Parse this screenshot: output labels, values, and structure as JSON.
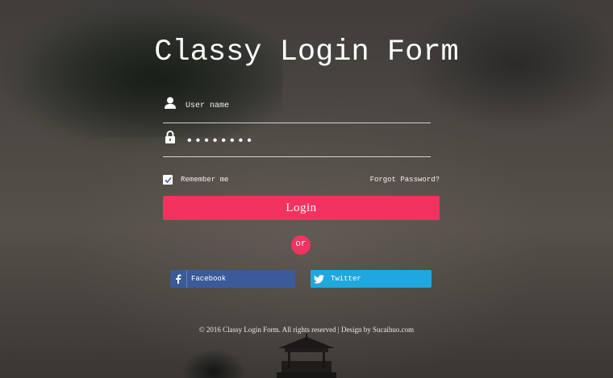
{
  "title": "Classy Login Form",
  "username": {
    "placeholder": "User name",
    "icon": "user-icon"
  },
  "password": {
    "value": "••••••••",
    "icon": "lock-icon"
  },
  "remember": {
    "label": "Remember me",
    "checked": true
  },
  "forgot_label": "Forgot Password?",
  "login_label": "Login",
  "or_label": "or",
  "social": {
    "facebook": {
      "label": "Facebook",
      "icon": "facebook-icon",
      "color": "#3b5a9a"
    },
    "twitter": {
      "label": "Twitter",
      "icon": "twitter-icon",
      "color": "#1fa7df"
    }
  },
  "footer": "© 2016 Classy Login Form. All rights reserved | Design by Sucaihuo.com",
  "colors": {
    "accent": "#f3325f"
  }
}
